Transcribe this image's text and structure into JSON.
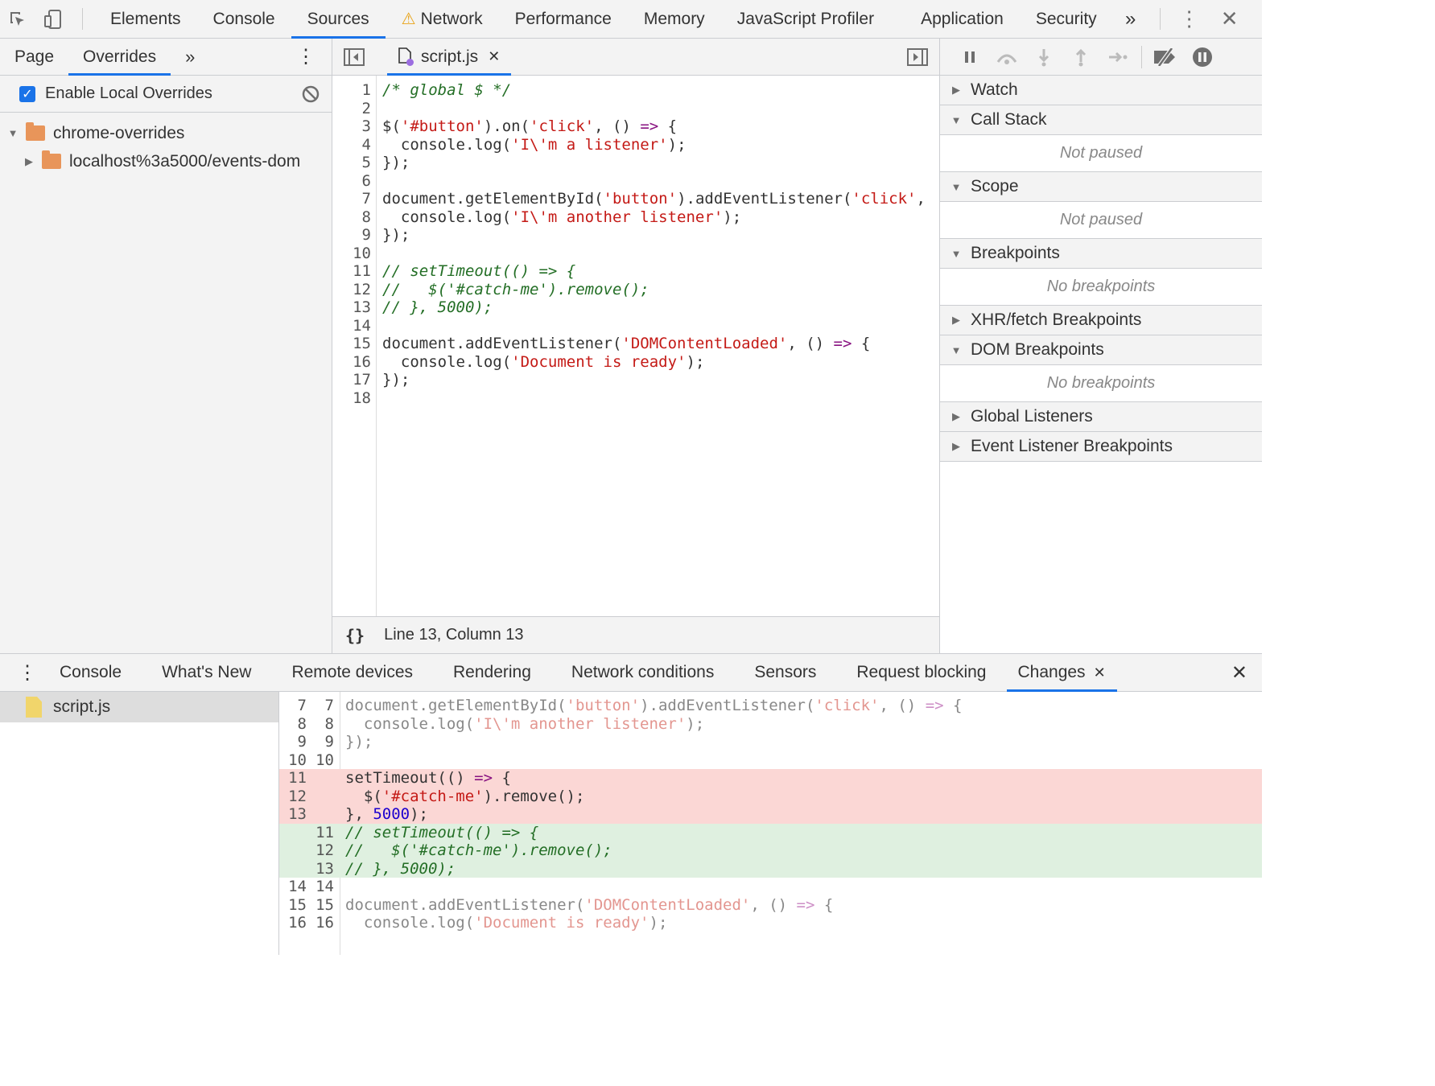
{
  "top_tabs": [
    "Elements",
    "Console",
    "Sources",
    "Network",
    "Performance",
    "Memory",
    "JavaScript Profiler",
    "Application",
    "Security"
  ],
  "active_top_tab": "Sources",
  "navigator": {
    "tabs": [
      "Page",
      "Overrides"
    ],
    "active": "Overrides",
    "enable_overrides_label": "Enable Local Overrides",
    "tree": [
      "chrome-overrides",
      "localhost%3a5000/events-dom"
    ]
  },
  "editor": {
    "file_tab": "script.js",
    "status": "Line 13, Column 13",
    "lines": [
      "/* global $ */",
      "",
      "$('#button').on('click', () => {",
      "  console.log('I\\'m a listener');",
      "});",
      "",
      "document.getElementById('button').addEventListener('click',",
      "  console.log('I\\'m another listener');",
      "});",
      "",
      "// setTimeout(() => {",
      "//   $('#catch-me').remove();",
      "// }, 5000);",
      "",
      "document.addEventListener('DOMContentLoaded', () => {",
      "  console.log('Document is ready');",
      "});",
      ""
    ]
  },
  "debugger": {
    "sections": [
      {
        "title": "Watch",
        "expanded": false
      },
      {
        "title": "Call Stack",
        "expanded": true,
        "body": "Not paused"
      },
      {
        "title": "Scope",
        "expanded": true,
        "body": "Not paused"
      },
      {
        "title": "Breakpoints",
        "expanded": true,
        "body": "No breakpoints"
      },
      {
        "title": "XHR/fetch Breakpoints",
        "expanded": false
      },
      {
        "title": "DOM Breakpoints",
        "expanded": true,
        "body": "No breakpoints"
      },
      {
        "title": "Global Listeners",
        "expanded": false
      },
      {
        "title": "Event Listener Breakpoints",
        "expanded": false
      }
    ]
  },
  "drawer": {
    "tabs": [
      "Console",
      "What's New",
      "Remote devices",
      "Rendering",
      "Network conditions",
      "Sensors",
      "Request blocking",
      "Changes"
    ],
    "active": "Changes",
    "changed_file": "script.js",
    "diff": [
      {
        "type": "ctx",
        "a": "7",
        "b": "7",
        "text": "document.getElementById('button').addEventListener('click', () => {"
      },
      {
        "type": "ctx",
        "a": "8",
        "b": "8",
        "text": "  console.log('I\\'m another listener');"
      },
      {
        "type": "ctx",
        "a": "9",
        "b": "9",
        "text": "});"
      },
      {
        "type": "ctx",
        "a": "10",
        "b": "10",
        "text": ""
      },
      {
        "type": "del",
        "a": "11",
        "b": "",
        "text": "setTimeout(() => {"
      },
      {
        "type": "del",
        "a": "12",
        "b": "",
        "text": "  $('#catch-me').remove();"
      },
      {
        "type": "del",
        "a": "13",
        "b": "",
        "text": "}, 5000);"
      },
      {
        "type": "add",
        "a": "",
        "b": "11",
        "text": "// setTimeout(() => {"
      },
      {
        "type": "add",
        "a": "",
        "b": "12",
        "text": "//   $('#catch-me').remove();"
      },
      {
        "type": "add",
        "a": "",
        "b": "13",
        "text": "// }, 5000);"
      },
      {
        "type": "ctx",
        "a": "14",
        "b": "14",
        "text": ""
      },
      {
        "type": "ctx",
        "a": "15",
        "b": "15",
        "text": "document.addEventListener('DOMContentLoaded', () => {"
      },
      {
        "type": "ctx",
        "a": "16",
        "b": "16",
        "text": "  console.log('Document is ready');"
      }
    ]
  }
}
